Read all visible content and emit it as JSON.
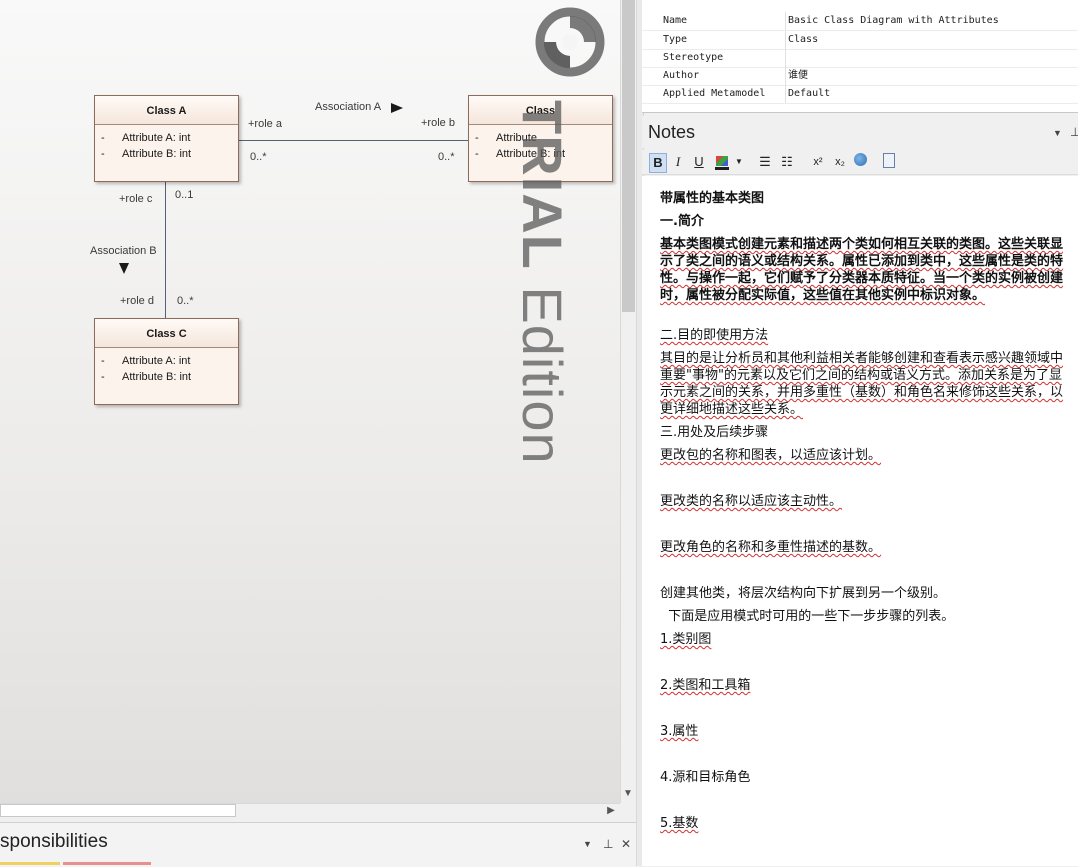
{
  "diagram": {
    "class_a": {
      "name": "Class A",
      "attrs": [
        {
          "vis": "-",
          "text": "Attribute A: int"
        },
        {
          "vis": "-",
          "text": "Attribute B: int"
        }
      ]
    },
    "class_b": {
      "name": "Class",
      "attrs": [
        {
          "vis": "-",
          "text": "Attribute"
        },
        {
          "vis": "-",
          "text": "Attribute B: int"
        }
      ]
    },
    "class_c": {
      "name": "Class C",
      "attrs": [
        {
          "vis": "-",
          "text": "Attribute A: int"
        },
        {
          "vis": "-",
          "text": "Attribute B: int"
        }
      ]
    },
    "assoc_a": {
      "name": "Association A",
      "role_a": "+role a",
      "role_b": "+role b",
      "mult_a": "0..*",
      "mult_b": "0..*"
    },
    "assoc_b": {
      "name": "Association B",
      "role_c": "+role c",
      "role_d": "+role d",
      "mult_c": "0..1",
      "mult_d": "0..*"
    },
    "watermark": {
      "bold": "TRIAL",
      "normal": " Edition"
    }
  },
  "bottom_panel": {
    "title": "sponsibilities",
    "dropdown_icon": "▼",
    "pin_icon": "📌",
    "close_icon": "✕"
  },
  "properties": [
    {
      "key": "Name",
      "value": "Basic Class Diagram with Attributes"
    },
    {
      "key": "Type",
      "value": "Class"
    },
    {
      "key": "Stereotype",
      "value": ""
    },
    {
      "key": "Author",
      "value": "谁便"
    },
    {
      "key": "Applied Metamodel",
      "value": "Default"
    }
  ],
  "notes": {
    "title": "Notes",
    "toolbar": {
      "bold": "B",
      "italic": "I",
      "underline": "U",
      "superscript": "x²",
      "subscript": "x₂"
    },
    "paragraphs": [
      {
        "text": "带属性的基本类图",
        "bold": true,
        "squiggle": false
      },
      {
        "text": "一.简介",
        "bold": true,
        "squiggle": false
      },
      {
        "text": "基本类图模式创建元素和描述两个类如何相互关联的类图。这些关联显示了类之间的语义或结构关系。属性已添加到类中，这些属性是类的特性。与操作一起，它们赋予了分类器本质特征。当一个类的实例被创建时，属性被分配实际值，这些值在其他实例中标识对象。",
        "bold": true,
        "squiggle": true
      },
      {
        "text": "二.目的即使用方法",
        "bold": false,
        "squiggle": true
      },
      {
        "text": "其目的是让分析员和其他利益相关者能够创建和查看表示感兴趣领域中重要\"事物\"的元素以及它们之间的结构或语义方式。添加关系是为了显示元素之间的关系，并用多重性（基数）和角色名来修饰这些关系，以更详细地描述这些关系。",
        "bold": false,
        "squiggle": true
      },
      {
        "text": "三.用处及后续步骤",
        "bold": false,
        "squiggle": false
      },
      {
        "text": "更改包的名称和图表，以适应该计划。",
        "bold": false,
        "squiggle": true
      },
      {
        "text": "更改类的名称以适应该主动性。",
        "bold": false,
        "squiggle": true
      },
      {
        "text": "更改角色的名称和多重性描述的基数。",
        "bold": false,
        "squiggle": true
      },
      {
        "text": "创建其他类，将层次结构向下扩展到另一个级别。",
        "bold": false,
        "squiggle": false
      },
      {
        "text": "  下面是应用模式时可用的一些下一步步骤的列表。",
        "bold": false,
        "squiggle": false
      },
      {
        "text": "1.类别图",
        "bold": false,
        "squiggle": true
      },
      {
        "text": "2.类图和工具箱",
        "bold": false,
        "squiggle": true
      },
      {
        "text": "3.属性",
        "bold": false,
        "squiggle": true
      },
      {
        "text": "4.源和目标角色",
        "bold": false,
        "squiggle": false
      },
      {
        "text": "5.基数",
        "bold": false,
        "squiggle": true
      }
    ]
  }
}
